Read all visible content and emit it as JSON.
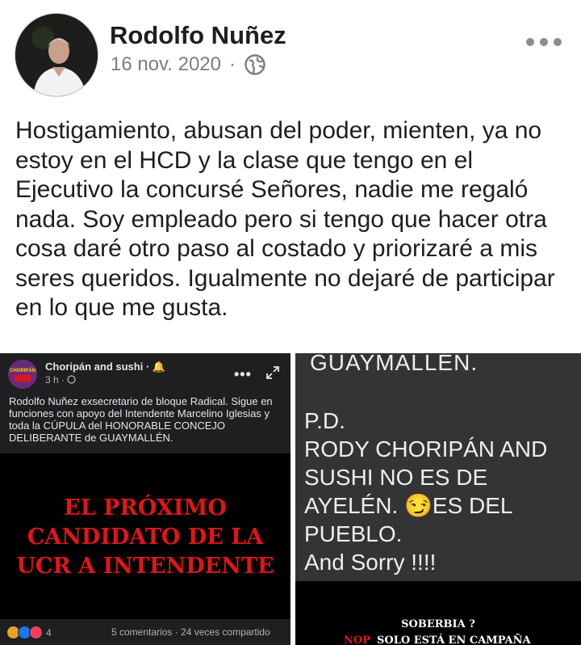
{
  "post": {
    "author": "Rodolfo Nuñez",
    "date": "16 nov. 2020",
    "separator": "·",
    "privacy_icon": "globe-icon",
    "text": "Hostigamiento, abusan del poder, mienten, ya no estoy en el HCD y la clase que tengo en el Ejecutivo la concursé Señores, nadie me regaló nada. Soy empleado pero si tengo que hacer otra cosa daré otro paso al costado y priorizaré  a mis seres queridos. Igualmente no dejaré de participar en lo que me gusta."
  },
  "left_image": {
    "page_name": "Choripán and sushi · 🔔",
    "page_time": "3 h · ",
    "logo_text": "CHORIPÁN",
    "caption": "Rodolfo Nuñez exsecretario de bloque Radical. Sigue en funciones con apoyo del Intendente Marcelino Iglesias y toda la CÚPULA del HONORABLE CONCEJO DELIBERANTE de GUAYMALLÉN.",
    "headline": [
      "EL PRÓXIMO",
      "CANDIDATO DE LA",
      "UCR A INTENDENTE"
    ],
    "reaction_count": "4",
    "stats": "5 comentarios · 24 veces compartido"
  },
  "right_image": {
    "top_text": "GUAYMALLÉN.",
    "body_text": "P.D.\nRODY  CHORIPÁN AND\nSUSHI NO ES DE\nAYELÉN.   😏ES DEL\nPUEBLO.\nAnd Sorry !!!!",
    "bottom_line1": "SOBERBIA ?",
    "bottom_line2_red": "NOP",
    "bottom_line2": "SOLO ESTÁ EN CAMPAÑA"
  },
  "colors": {
    "headline_red": "#e0151a",
    "text_dark": "#1c1e21",
    "meta_gray": "#7a7d82"
  }
}
